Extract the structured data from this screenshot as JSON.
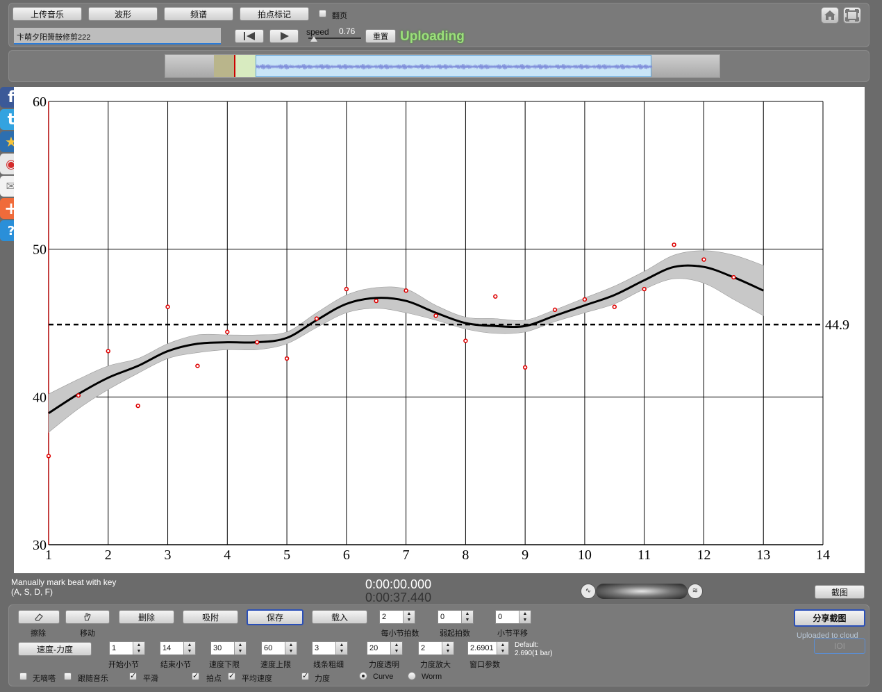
{
  "toolbar": {
    "upload_music": "上传音乐",
    "waveform": "波形",
    "spectrum": "频谱",
    "beat_mark": "拍点标记",
    "page_turn": "翻页",
    "filename": "卞萌夕阳箫鼓修剪222",
    "speed_label": "speed",
    "speed_value": "0.76",
    "speed_fraction": 0.1,
    "reset": "重置",
    "status": "Uploading"
  },
  "chart_data": {
    "type": "line",
    "xlim": [
      1,
      14
    ],
    "ylim": [
      30,
      60
    ],
    "x_ticks": [
      "1",
      "2",
      "3",
      "4",
      "5",
      "6",
      "7",
      "8",
      "9",
      "10",
      "11",
      "12",
      "13",
      "14"
    ],
    "y_ticks": [
      "30",
      "40",
      "50",
      "60"
    ],
    "mean_line": {
      "value": 44.9,
      "label": "44.9"
    },
    "grid": true,
    "beats": [
      {
        "x": 1.0,
        "y": 36.0
      },
      {
        "x": 1.5,
        "y": 40.1
      },
      {
        "x": 2.0,
        "y": 43.1
      },
      {
        "x": 2.5,
        "y": 39.4
      },
      {
        "x": 3.0,
        "y": 46.1
      },
      {
        "x": 3.5,
        "y": 42.1
      },
      {
        "x": 4.0,
        "y": 44.4
      },
      {
        "x": 4.5,
        "y": 43.7
      },
      {
        "x": 5.0,
        "y": 42.6
      },
      {
        "x": 5.5,
        "y": 45.3
      },
      {
        "x": 6.0,
        "y": 47.3
      },
      {
        "x": 6.5,
        "y": 46.5
      },
      {
        "x": 7.0,
        "y": 47.2
      },
      {
        "x": 7.5,
        "y": 45.5
      },
      {
        "x": 8.0,
        "y": 43.8
      },
      {
        "x": 8.5,
        "y": 46.8
      },
      {
        "x": 9.0,
        "y": 42.0
      },
      {
        "x": 9.5,
        "y": 45.9
      },
      {
        "x": 10.0,
        "y": 46.6
      },
      {
        "x": 10.5,
        "y": 46.1
      },
      {
        "x": 11.0,
        "y": 47.3
      },
      {
        "x": 11.5,
        "y": 50.3
      },
      {
        "x": 12.0,
        "y": 49.3
      },
      {
        "x": 12.5,
        "y": 48.1
      }
    ],
    "smooth": [
      {
        "x": 1.0,
        "y": 38.9
      },
      {
        "x": 1.5,
        "y": 40.2
      },
      {
        "x": 2.0,
        "y": 41.3
      },
      {
        "x": 2.5,
        "y": 42.1
      },
      {
        "x": 3.0,
        "y": 43.1
      },
      {
        "x": 3.5,
        "y": 43.6
      },
      {
        "x": 4.0,
        "y": 43.7
      },
      {
        "x": 4.5,
        "y": 43.7
      },
      {
        "x": 5.0,
        "y": 44.0
      },
      {
        "x": 5.5,
        "y": 45.2
      },
      {
        "x": 6.0,
        "y": 46.3
      },
      {
        "x": 6.5,
        "y": 46.7
      },
      {
        "x": 7.0,
        "y": 46.5
      },
      {
        "x": 7.5,
        "y": 45.7
      },
      {
        "x": 8.0,
        "y": 45.0
      },
      {
        "x": 8.5,
        "y": 44.8
      },
      {
        "x": 9.0,
        "y": 44.8
      },
      {
        "x": 9.5,
        "y": 45.5
      },
      {
        "x": 10.0,
        "y": 46.2
      },
      {
        "x": 10.5,
        "y": 46.9
      },
      {
        "x": 11.0,
        "y": 47.9
      },
      {
        "x": 11.5,
        "y": 48.8
      },
      {
        "x": 12.0,
        "y": 48.8
      },
      {
        "x": 12.5,
        "y": 48.1
      },
      {
        "x": 13.0,
        "y": 47.2
      }
    ],
    "band_halfwidth": [
      1.3,
      1.0,
      0.8,
      0.5,
      0.5,
      0.6,
      0.5,
      0.5,
      0.4,
      0.5,
      0.6,
      0.7,
      0.8,
      0.5,
      0.4,
      0.5,
      0.4,
      0.4,
      0.5,
      0.6,
      0.6,
      0.8,
      1.1,
      1.5,
      1.7
    ]
  },
  "hint": {
    "line1": "Manually mark beat with key",
    "line2": "(A, S, D, F)"
  },
  "time": {
    "current": "0:00:00.000",
    "total": "0:00:37.440"
  },
  "screenshot_button": "截图",
  "bottom": {
    "erase": "擦除",
    "move": "移动",
    "delete": "删除",
    "snap": "吸附",
    "save": "保存",
    "load": "载入",
    "beats_per_bar": {
      "value": "2",
      "label": "每小节拍数"
    },
    "pickup_beats": {
      "value": "0",
      "label": "弱起拍数"
    },
    "bar_shift": {
      "value": "0",
      "label": "小节平移"
    },
    "share_screenshot": "分享截图",
    "uploaded": "Uploaded to cloud",
    "ioi": "IOI",
    "mode": "速度-力度",
    "start_bar": {
      "value": "1",
      "label": "开始小节"
    },
    "end_bar": {
      "value": "14",
      "label": "结束小节"
    },
    "tempo_min": {
      "value": "30",
      "label": "速度下限"
    },
    "tempo_max": {
      "value": "60",
      "label": "速度上限"
    },
    "line_width": {
      "value": "3",
      "label": "线条粗细"
    },
    "dyn_opacity": {
      "value": "20",
      "label": "力度透明"
    },
    "dyn_scale": {
      "value": "2",
      "label": "力度放大"
    },
    "window_param": {
      "value": "2.6901",
      "label": "窗口参数"
    },
    "default_line1": "Default:",
    "default_line2": "2.690(1 bar)",
    "opt_no_click": "无嘀嗒",
    "opt_follow": "跟随音乐",
    "opt_smooth": "平滑",
    "opt_beats": "拍点",
    "opt_avg_tempo": "平均速度",
    "opt_dynamics": "力度",
    "radio_curve": "Curve",
    "radio_worm": "Worm"
  },
  "colors": {
    "beat": "#dd0000",
    "curve": "#000000",
    "band": "#c8c8c8",
    "status": "#9be07a"
  }
}
